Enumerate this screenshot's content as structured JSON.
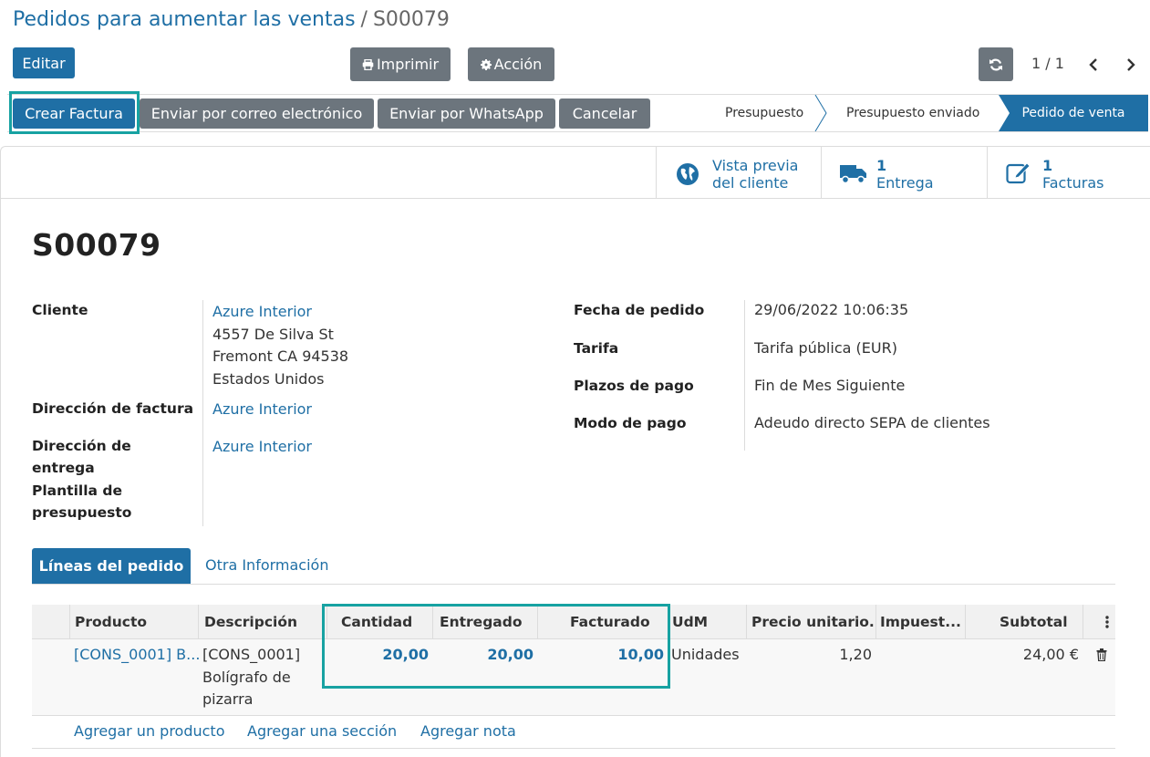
{
  "breadcrumb": {
    "parent": "Pedidos para aumentar las ventas",
    "separator": "/",
    "current": "S00079"
  },
  "toolbar": {
    "edit_label": "Editar",
    "print_label": "Imprimir",
    "action_label": "Acción"
  },
  "pager": {
    "value": "1 / 1"
  },
  "actions": {
    "create_invoice": "Crear Factura",
    "send_email": "Enviar por correo electrónico",
    "send_whatsapp": "Enviar por WhatsApp",
    "cancel": "Cancelar"
  },
  "stages": {
    "quotation": "Presupuesto",
    "quotation_sent": "Presupuesto enviado",
    "sale_order": "Pedido de venta",
    "active": "Pedido de venta"
  },
  "smart_buttons": {
    "preview_line1": "Vista previa",
    "preview_line2": "del cliente",
    "delivery_count": "1",
    "delivery_label": "Entrega",
    "invoices_count": "1",
    "invoices_label": "Facturas"
  },
  "record": {
    "name": "S00079"
  },
  "fields": {
    "customer_label": "Cliente",
    "customer_name": "Azure Interior",
    "customer_address_1": "4557 De Silva St",
    "customer_address_2": "Fremont CA 94538",
    "customer_address_3": "Estados Unidos",
    "invoice_address_label": "Dirección de factura",
    "invoice_address": "Azure Interior",
    "delivery_address_label_1": "Dirección de",
    "delivery_address_label_2": "entrega",
    "delivery_address": "Azure Interior",
    "template_label_1": "Plantilla de",
    "template_label_2": "presupuesto",
    "order_date_label": "Fecha de pedido",
    "order_date": "29/06/2022 10:06:35",
    "pricelist_label": "Tarifa",
    "pricelist": "Tarifa pública (EUR)",
    "payment_terms_label": "Plazos de pago",
    "payment_terms": "Fin de Mes Siguiente",
    "payment_mode_label": "Modo de pago",
    "payment_mode": "Adeudo directo SEPA de clientes"
  },
  "tabs": {
    "order_lines": "Líneas del pedido",
    "other_info": "Otra Información"
  },
  "table": {
    "headers": {
      "product": "Producto",
      "description": "Descripción",
      "quantity": "Cantidad",
      "delivered": "Entregado",
      "invoiced": "Facturado",
      "uom": "UdM",
      "unit_price": "Precio unitario...",
      "taxes": "Impuest...",
      "subtotal": "Subtotal"
    },
    "rows": [
      {
        "product": "[CONS_0001] B...",
        "description_1": "[CONS_0001]",
        "description_2": "Bolígrafo de",
        "description_3": "pizarra",
        "quantity": "20,00",
        "delivered": "20,00",
        "invoiced": "10,00",
        "uom": "Unidades",
        "unit_price": "1,20",
        "taxes": "",
        "subtotal": "24,00 €"
      }
    ],
    "add_product": "Agregar un producto",
    "add_section": "Agregar una sección",
    "add_note": "Agregar nota"
  },
  "icons": {
    "print": "printer-icon",
    "action": "gear-icon",
    "refresh": "refresh-icon",
    "preview": "globe-icon",
    "delivery": "truck-icon",
    "invoices": "edit-icon",
    "delete": "trash-icon",
    "options": "kebab-icon"
  },
  "colors": {
    "primary": "#1f6fa5",
    "secondary": "#6c757d",
    "highlight": "#17a2a2"
  }
}
